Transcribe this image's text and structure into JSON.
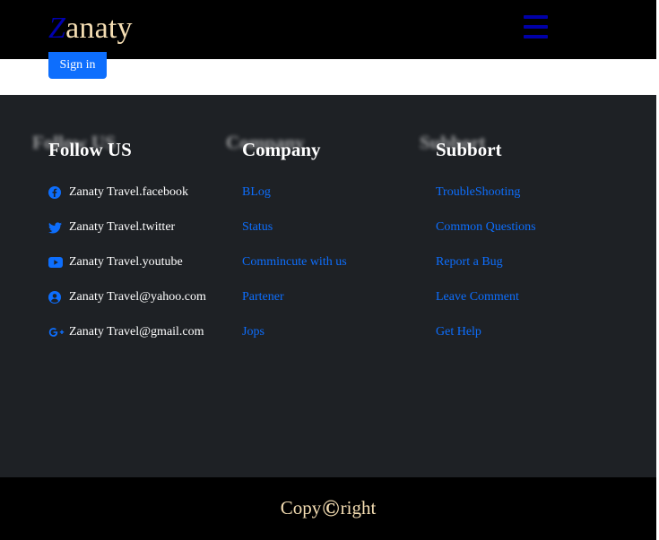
{
  "navbar": {
    "brand_first": "Z",
    "brand_rest": "anaty",
    "menu_icon": "hamburger-menu-icon",
    "signin_label": "Sign in"
  },
  "footer": {
    "follow": {
      "title": "Follow US",
      "items": [
        {
          "icon": "facebook-icon",
          "label": "Zanaty Travel.facebook"
        },
        {
          "icon": "twitter-icon",
          "label": "Zanaty Travel.twitter"
        },
        {
          "icon": "youtube-icon",
          "label": "Zanaty Travel.youtube"
        },
        {
          "icon": "user-circle-icon",
          "label": "Zanaty Travel@yahoo.com"
        },
        {
          "icon": "google-plus-icon",
          "label": "Zanaty Travel@gmail.com"
        }
      ]
    },
    "company": {
      "title": "Company",
      "items": [
        "BLog",
        "Status",
        "Commincute with us",
        "Partener",
        "Jops"
      ]
    },
    "support": {
      "title": "Subbort",
      "items": [
        "TroubleShooting",
        "Common Questions",
        "Report a Bug",
        "Leave Comment",
        "Get Help"
      ]
    }
  },
  "bottom": {
    "copy_before": "Copy",
    "copy_symbol": "©",
    "copy_after": "right"
  },
  "colors": {
    "navbar_bg": "#000000",
    "brand_accent": "#0000b0",
    "brand_text": "#f5deb3",
    "footer_bg": "#1e2125",
    "link": "#0d6efd",
    "button": "#0d6efd"
  }
}
